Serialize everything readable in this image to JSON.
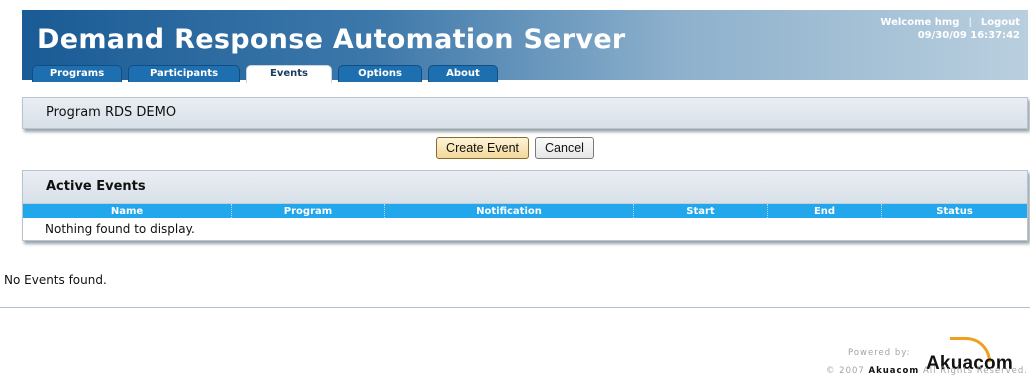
{
  "header": {
    "title": "Demand Response Automation Server",
    "welcome": "Welcome hmg",
    "separator": "|",
    "logout": "Logout",
    "datetime": "09/30/09 16:37:42"
  },
  "tabs": [
    {
      "label": "Programs",
      "active": false
    },
    {
      "label": "Participants",
      "active": false
    },
    {
      "label": "Events",
      "active": true
    },
    {
      "label": "Options",
      "active": false
    },
    {
      "label": "About",
      "active": false
    }
  ],
  "program_panel": {
    "title": "Program RDS DEMO"
  },
  "actions": {
    "create_event": "Create Event",
    "cancel": "Cancel"
  },
  "active_events": {
    "title": "Active Events",
    "columns": [
      "Name",
      "Program",
      "Notification",
      "Start",
      "End",
      "Status"
    ],
    "empty_message": "Nothing found to display."
  },
  "status_message": "No Events found.",
  "footer": {
    "powered_by": "Powered by:",
    "logo_text": "Akuacom",
    "copyright_prefix": "© 2007",
    "copyright_brand": "Akuacom",
    "copyright_suffix": "All Rights Reserved."
  },
  "colors": {
    "header_start": "#1a5b95",
    "header_end": "#b9cfde",
    "tab": "#1e6fb0",
    "grid_header": "#22a6ec",
    "logo_accent": "#f0a020"
  }
}
